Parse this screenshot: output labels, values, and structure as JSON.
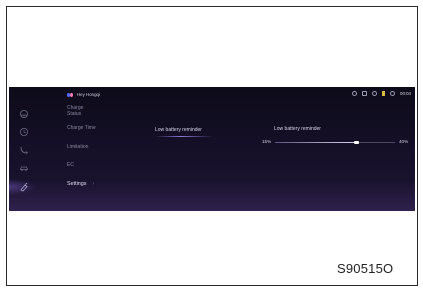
{
  "status_bar": {
    "assistant_label": "Hey Hongqi",
    "clock": "00:04"
  },
  "menu": {
    "items": [
      {
        "label_line1": "Charge",
        "label_line2": "Status"
      },
      {
        "label_line1": "Charge Time"
      },
      {
        "label_line1": "Limitation"
      },
      {
        "label_line1": "EC"
      },
      {
        "label_line1": "Settings",
        "chevron": "›"
      }
    ]
  },
  "content": {
    "option_label": "Low battery reminder",
    "slider": {
      "title": "Low battery reminder",
      "min_label": "15%",
      "max_label": "40%",
      "value_fraction": 0.68
    }
  },
  "rail_icons": [
    "steering-icon",
    "clock-icon",
    "plug-icon",
    "car-icon",
    "charger-icon"
  ],
  "colors": {
    "screen_bg": "#161029",
    "accent": "#8f7ae0",
    "text_primary": "#e6e4f2",
    "text_secondary": "#8886a2"
  },
  "figure_code": "S90515O"
}
